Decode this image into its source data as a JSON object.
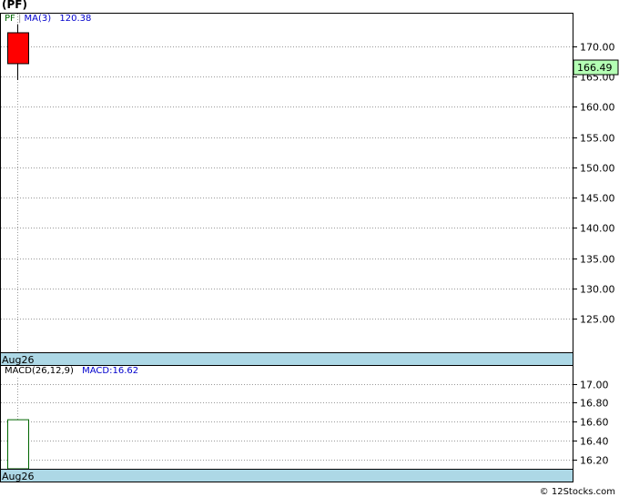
{
  "header": {
    "title": "(PF)"
  },
  "price_legend": {
    "symbol": "PF",
    "ma_label": "MA(3)",
    "ma_value": "120.38"
  },
  "macd_legend": {
    "label": "MACD(26,12,9)",
    "value_text": "MACD:16.62"
  },
  "footer": {
    "credit": "© 12Stocks.com"
  },
  "colors": {
    "down_candle": "#ff0000",
    "price_tag_bg": "#b4ffb4",
    "date_band": "#add8e6",
    "ma_text": "#0000cc",
    "symbol_text": "#006600",
    "macd_bar": "#006600"
  },
  "chart_data": [
    {
      "type": "candlestick",
      "title": "(PF)",
      "x_label": "Aug26",
      "candles": [
        {
          "x": "Aug26",
          "open": 172.2,
          "high": 173.6,
          "low": 164.4,
          "close": 167.1
        }
      ],
      "moving_average": {
        "name": "MA(3)",
        "value": 120.38
      },
      "last_price": 166.49,
      "ylim": [
        119.5,
        175.5
      ],
      "y_ticks": [
        125,
        130,
        135,
        140,
        145,
        150,
        155,
        160,
        165,
        170
      ],
      "y_tick_labels": [
        "125.00",
        "130.00",
        "135.00",
        "140.00",
        "145.00",
        "150.00",
        "155.00",
        "160.00",
        "165.00",
        "170.00"
      ],
      "grid": true
    },
    {
      "type": "bar",
      "title": "MACD(26,12,9)",
      "x_label": "Aug26",
      "categories": [
        "Aug26"
      ],
      "values": [
        16.62
      ],
      "ylim": [
        16.1,
        17.2
      ],
      "y_ticks": [
        16.2,
        16.4,
        16.6,
        16.8,
        17.0
      ],
      "y_tick_labels": [
        "16.20",
        "16.40",
        "16.60",
        "16.80",
        "17.00"
      ],
      "grid": true
    }
  ]
}
